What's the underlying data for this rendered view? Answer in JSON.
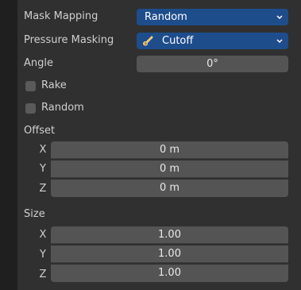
{
  "mask_mapping": {
    "label": "Mask Mapping",
    "value": "Random"
  },
  "pressure_masking": {
    "label": "Pressure Masking",
    "value": "Cutoff",
    "icon": "brush-icon"
  },
  "angle": {
    "label": "Angle",
    "value": "0°"
  },
  "rake": {
    "label": "Rake",
    "checked": false
  },
  "random": {
    "label": "Random",
    "checked": false
  },
  "offset": {
    "label": "Offset",
    "axes": [
      {
        "axis": "X",
        "value": "0 m"
      },
      {
        "axis": "Y",
        "value": "0 m"
      },
      {
        "axis": "Z",
        "value": "0 m"
      }
    ]
  },
  "size": {
    "label": "Size",
    "axes": [
      {
        "axis": "X",
        "value": "1.00"
      },
      {
        "axis": "Y",
        "value": "1.00"
      },
      {
        "axis": "Z",
        "value": "1.00"
      }
    ]
  },
  "colors": {
    "panel_bg": "#303030",
    "dropdown_bg": "#1e4d8c",
    "field_bg": "#545454"
  }
}
